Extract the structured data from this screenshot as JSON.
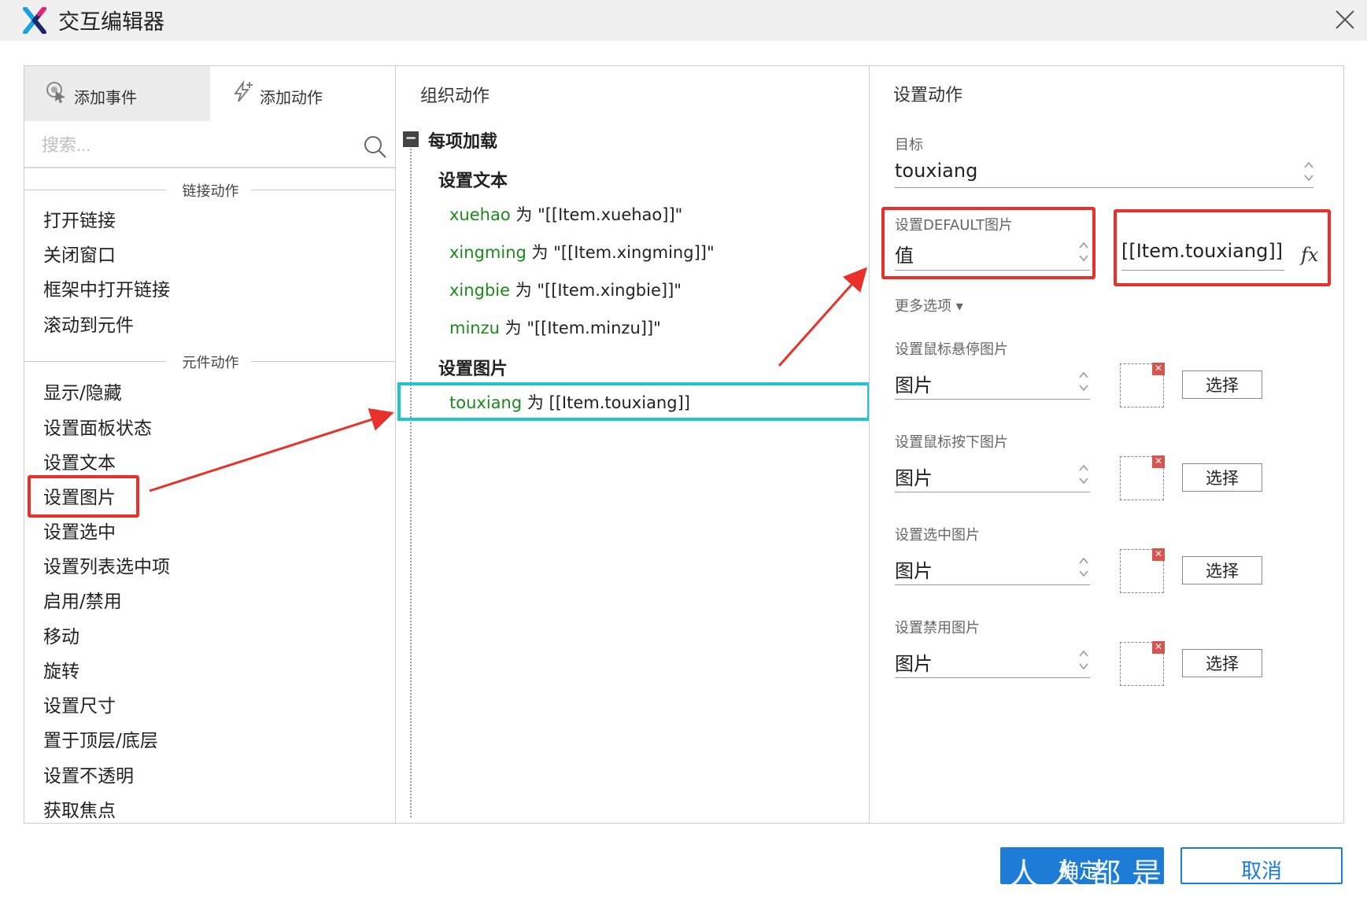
{
  "window": {
    "title": "交互编辑器"
  },
  "left_panel": {
    "tabs": [
      {
        "label": "添加事件"
      },
      {
        "label": "添加动作"
      }
    ],
    "search": {
      "placeholder": "搜索..."
    },
    "groups": [
      {
        "header": "链接动作",
        "items": [
          "打开链接",
          "关闭窗口",
          "框架中打开链接",
          "滚动到元件"
        ]
      },
      {
        "header": "元件动作",
        "items": [
          "显示/隐藏",
          "设置面板状态",
          "设置文本",
          "设置图片",
          "设置选中",
          "设置列表选中项",
          "启用/禁用",
          "移动",
          "旋转",
          "设置尺寸",
          "置于顶层/底层",
          "设置不透明",
          "获取焦点"
        ]
      }
    ]
  },
  "middle_panel": {
    "title": "组织动作",
    "event": "每项加载",
    "toggle_symbol": "−",
    "sections": [
      {
        "title": "设置文本",
        "actions": [
          {
            "widget": "xuehao",
            "verb": "为",
            "value": "\"[[Item.xuehao]]\""
          },
          {
            "widget": "xingming",
            "verb": "为",
            "value": "\"[[Item.xingming]]\""
          },
          {
            "widget": "xingbie",
            "verb": "为",
            "value": "\"[[Item.xingbie]]\""
          },
          {
            "widget": "minzu",
            "verb": "为",
            "value": "\"[[Item.minzu]]\""
          }
        ]
      },
      {
        "title": "设置图片",
        "actions": [
          {
            "widget": "touxiang",
            "verb": "为",
            "value": "[[Item.touxiang]]"
          }
        ]
      }
    ]
  },
  "right_panel": {
    "title": "设置动作",
    "target": {
      "label": "目标",
      "value": "touxiang"
    },
    "default_image": {
      "label": "设置DEFAULT图片",
      "type": "值",
      "value": "[[Item.touxiang]]",
      "fx": "fx"
    },
    "more_options": "更多选项 ▾",
    "image_settings": [
      {
        "label": "设置鼠标悬停图片",
        "type": "图片",
        "button": "选择"
      },
      {
        "label": "设置鼠标按下图片",
        "type": "图片",
        "button": "选择"
      },
      {
        "label": "设置选中图片",
        "type": "图片",
        "button": "选择"
      },
      {
        "label": "设置禁用图片",
        "type": "图片",
        "button": "选择"
      }
    ]
  },
  "footer": {
    "ok": "确定",
    "cancel": "取消"
  },
  "watermark": "人人都是",
  "colors": {
    "highlight_red": "#e8312a",
    "selected_cyan": "#1fc4cf",
    "widget_green": "#1a8a1a",
    "primary_blue": "#1e7bd6"
  }
}
